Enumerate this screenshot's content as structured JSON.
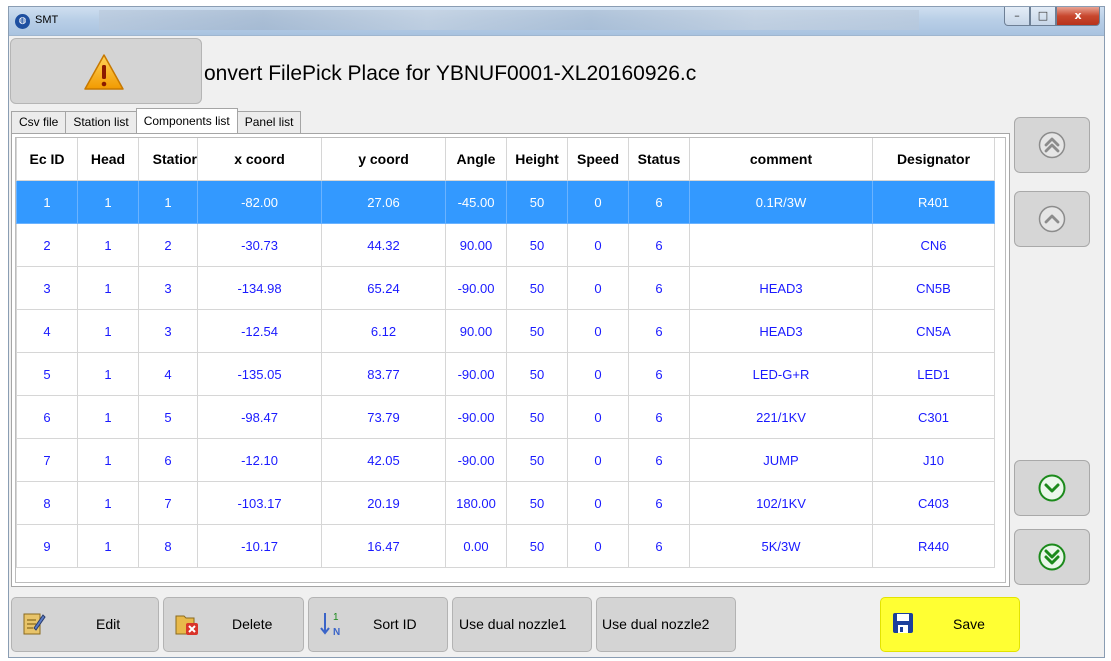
{
  "window": {
    "title": "SMT",
    "controls": {
      "minimize": "–",
      "maximize": "□",
      "close": "x"
    }
  },
  "header": {
    "file_title": "onvert FilePick Place for YBNUF0001-XL20160926.c"
  },
  "tabs": [
    {
      "label": "Csv file"
    },
    {
      "label": "Station list"
    },
    {
      "label": "Components list",
      "active": true
    },
    {
      "label": "Panel list"
    }
  ],
  "table": {
    "columns": [
      "Ec ID",
      "Head",
      "Statior",
      "x coord",
      "y coord",
      "Angle",
      "Height",
      "Speed",
      "Status",
      "comment",
      "Designator"
    ],
    "rows": [
      [
        "1",
        "1",
        "1",
        "-82.00",
        "27.06",
        "-45.00",
        "50",
        "0",
        "6",
        "0.1R/3W",
        "R401"
      ],
      [
        "2",
        "1",
        "2",
        "-30.73",
        "44.32",
        "90.00",
        "50",
        "0",
        "6",
        "",
        "CN6"
      ],
      [
        "3",
        "1",
        "3",
        "-134.98",
        "65.24",
        "-90.00",
        "50",
        "0",
        "6",
        "HEAD3",
        "CN5B"
      ],
      [
        "4",
        "1",
        "3",
        "-12.54",
        "6.12",
        "90.00",
        "50",
        "0",
        "6",
        "HEAD3",
        "CN5A"
      ],
      [
        "5",
        "1",
        "4",
        "-135.05",
        "83.77",
        "-90.00",
        "50",
        "0",
        "6",
        "LED-G+R",
        "LED1"
      ],
      [
        "6",
        "1",
        "5",
        "-98.47",
        "73.79",
        "-90.00",
        "50",
        "0",
        "6",
        "221/1KV",
        "C301"
      ],
      [
        "7",
        "1",
        "6",
        "-12.10",
        "42.05",
        "-90.00",
        "50",
        "0",
        "6",
        "JUMP",
        "J10"
      ],
      [
        "8",
        "1",
        "7",
        "-103.17",
        "20.19",
        "180.00",
        "50",
        "0",
        "6",
        "102/1KV",
        "C403"
      ],
      [
        "9",
        "1",
        "8",
        "-10.17",
        "16.47",
        "0.00",
        "50",
        "0",
        "6",
        "5K/3W",
        "R440"
      ]
    ],
    "selected_row": 0
  },
  "buttons": {
    "edit": "Edit",
    "delete": "Delete",
    "sort_id": "Sort ID",
    "dual1": "Use dual nozzle1",
    "dual2": "Use dual nozzle2",
    "save": "Save"
  },
  "colors": {
    "selected_row": "#3399ff",
    "cell_text": "#1a1aff",
    "save_button": "#ffff33"
  }
}
